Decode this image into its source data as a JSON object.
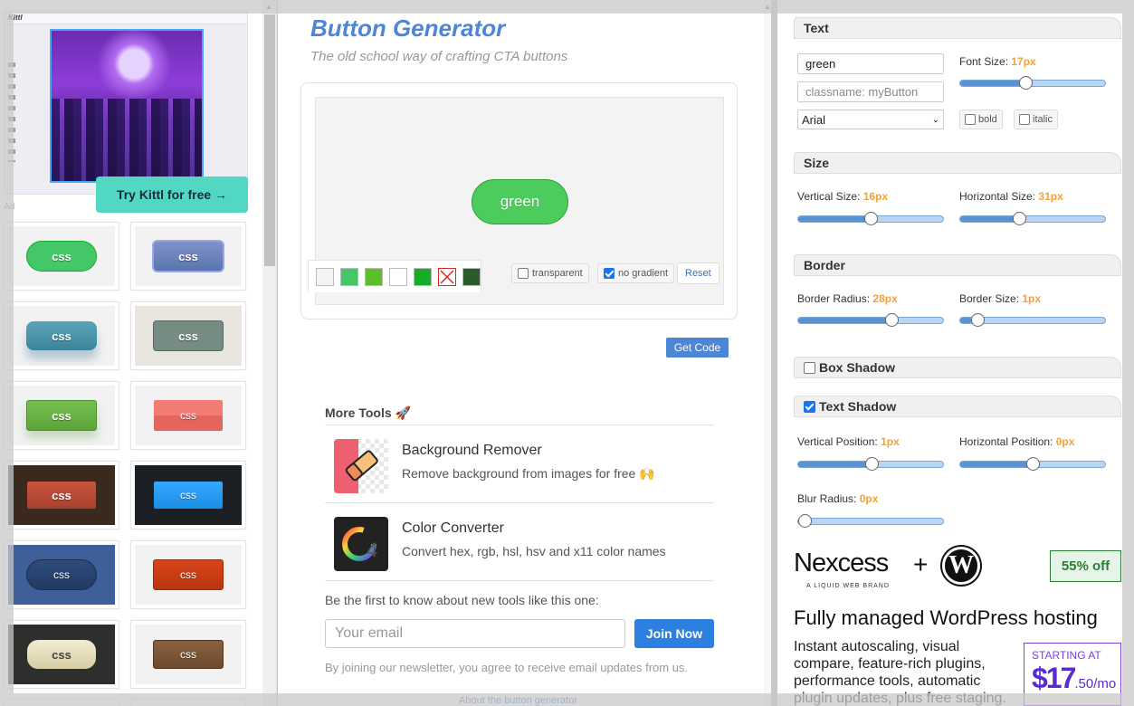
{
  "left_panel": {
    "ad": {
      "brand": "Kittl",
      "cta": "Try Kittl for free →",
      "ad_label": "Ad"
    },
    "gallery": [
      {
        "label": "css"
      },
      {
        "label": "css"
      },
      {
        "label": "css"
      },
      {
        "label": "css"
      },
      {
        "label": "css"
      },
      {
        "label": "css"
      },
      {
        "label": "css"
      },
      {
        "label": "css"
      },
      {
        "label": "css"
      },
      {
        "label": "css"
      },
      {
        "label": "css"
      },
      {
        "label": "css"
      }
    ]
  },
  "main": {
    "title": "Button Generator",
    "subtitle": "The old school way of crafting CTA buttons",
    "preview_button": "green",
    "swatches": [
      "#f4f4f4",
      "#44c767",
      "#5cbf2a",
      "#ffffff",
      "#18ab29",
      "none",
      "#2a5c2a"
    ],
    "options": {
      "transparent": "transparent",
      "transparent_checked": false,
      "no_gradient": "no gradient",
      "no_gradient_checked": true,
      "reset": "Reset"
    },
    "get_code": "Get Code",
    "more_tools": {
      "heading": "More Tools 🚀",
      "items": [
        {
          "name": "Background Remover",
          "desc": "Remove background from images for free 🙌"
        },
        {
          "name": "Color Converter",
          "desc": "Convert hex, rgb, hsl, hsv and x11 color names"
        }
      ]
    },
    "newsletter": {
      "prompt": "Be the first to know about new tools like this one:",
      "email_placeholder": "Your email",
      "join": "Join Now",
      "disclaimer": "By joining our newsletter, you agree to receive email updates from us."
    },
    "about_link": "About the button generator"
  },
  "settings": {
    "text": {
      "heading": "Text",
      "text_value": "green",
      "classname_placeholder": "classname: myButton",
      "font": "Arial",
      "bold": "bold",
      "italic": "italic",
      "font_size_label": "Font Size:",
      "font_size": "17px"
    },
    "size": {
      "heading": "Size",
      "vertical_label": "Vertical Size:",
      "vertical": "16px",
      "horizontal_label": "Horizontal Size:",
      "horizontal": "31px"
    },
    "border": {
      "heading": "Border",
      "radius_label": "Border Radius:",
      "radius": "28px",
      "size_label": "Border Size:",
      "size": "1px"
    },
    "box_shadow": {
      "heading": "Box Shadow",
      "checked": false
    },
    "text_shadow": {
      "heading": "Text Shadow",
      "checked": true,
      "vpos_label": "Vertical Position:",
      "vpos": "1px",
      "hpos_label": "Horizontal Position:",
      "hpos": "0px",
      "blur_label": "Blur Radius:",
      "blur": "0px"
    },
    "slider_levels": {
      "font_size": 0.45,
      "vertical_size": 0.5,
      "horizontal_size": 0.4,
      "border_radius": 0.66,
      "border_size": 0.08,
      "text_shadow_vertical": 0.51,
      "text_shadow_horizontal": 0.5,
      "text_shadow_blur": 0.0
    }
  },
  "right_ad": {
    "brand": "Nexcess",
    "brand_sub": "A LIQUID WEB BRAND",
    "plus": "+",
    "discount": "55% off",
    "headline": "Fully managed WordPress hosting",
    "body": "Instant autoscaling, visual compare, feature-rich plugins, performance tools, automatic plugin updates, plus free staging.",
    "price_label": "STARTING AT",
    "price_main": "$17",
    "price_cents": ".50/mo"
  },
  "colors": {
    "accent": "#4e86d6",
    "preview_button": "#4ccc5c",
    "highlight": "#f4a137",
    "join": "#2d7fe0",
    "kittl_cta": "#52d8c2"
  }
}
